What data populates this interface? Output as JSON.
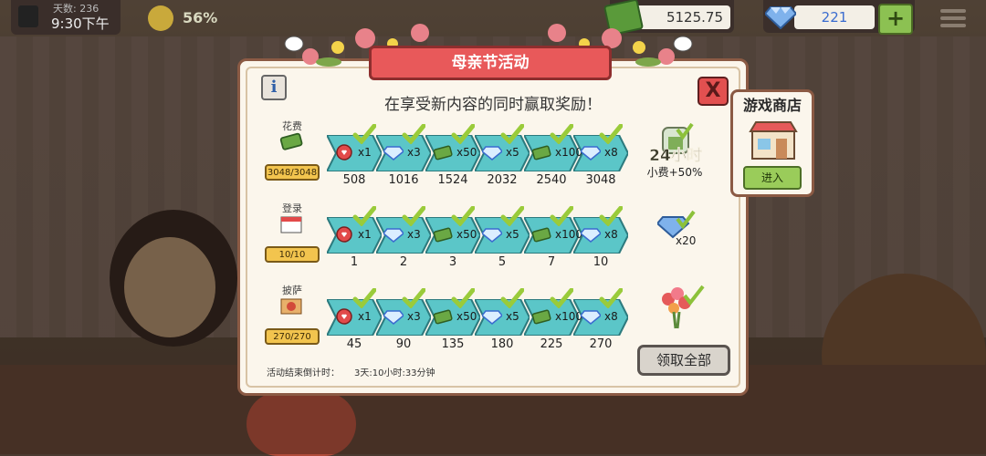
{
  "hud": {
    "day_label": "天数: 236",
    "time": "9:30下午",
    "mood_percent": "56%",
    "money": "5125.75",
    "gems": "221",
    "plus_label": "+"
  },
  "dialog": {
    "title": "母亲节活动",
    "subtitle": "在享受新内容的同时赢取奖励！",
    "info_label": "i",
    "close_label": "X",
    "collect_all_label": "领取全部",
    "countdown_label": "活动结束倒计时：",
    "countdown_value": "3天:10小时:33分钟",
    "rows": [
      {
        "label": "花费",
        "progress": "3048/3048",
        "tiers": [
          {
            "icon": "heart-coin-icon",
            "qty": "x1",
            "threshold": "508"
          },
          {
            "icon": "gem-icon",
            "qty": "x3",
            "threshold": "1016"
          },
          {
            "icon": "cash-icon",
            "qty": "x50",
            "threshold": "1524"
          },
          {
            "icon": "gem-icon",
            "qty": "x5",
            "threshold": "2032"
          },
          {
            "icon": "cash-icon",
            "qty": "x100",
            "threshold": "2540"
          },
          {
            "icon": "gem-icon",
            "qty": "x8",
            "threshold": "3048"
          }
        ],
        "final_reward": {
          "time": "24小时",
          "tip": "小费+50%"
        }
      },
      {
        "label": "登录",
        "progress": "10/10",
        "tiers": [
          {
            "icon": "heart-coin-icon",
            "qty": "x1",
            "threshold": "1"
          },
          {
            "icon": "gem-icon",
            "qty": "x3",
            "threshold": "2"
          },
          {
            "icon": "cash-icon",
            "qty": "x50",
            "threshold": "3"
          },
          {
            "icon": "gem-icon",
            "qty": "x5",
            "threshold": "5"
          },
          {
            "icon": "cash-icon",
            "qty": "x100",
            "threshold": "7"
          },
          {
            "icon": "gem-icon",
            "qty": "x8",
            "threshold": "10"
          }
        ],
        "final_reward": {
          "qty": "x20"
        }
      },
      {
        "label": "披萨",
        "progress": "270/270",
        "tiers": [
          {
            "icon": "heart-coin-icon",
            "qty": "x1",
            "threshold": "45"
          },
          {
            "icon": "gem-icon",
            "qty": "x3",
            "threshold": "90"
          },
          {
            "icon": "cash-icon",
            "qty": "x50",
            "threshold": "135"
          },
          {
            "icon": "gem-icon",
            "qty": "x5",
            "threshold": "180"
          },
          {
            "icon": "cash-icon",
            "qty": "x100",
            "threshold": "225"
          },
          {
            "icon": "gem-icon",
            "qty": "x8",
            "threshold": "270"
          }
        ],
        "final_reward": {
          "icon": "flower-bouquet-icon"
        }
      }
    ]
  },
  "shop": {
    "title": "游戏商店",
    "enter_label": "进入"
  },
  "colors": {
    "banner": "#e8595a",
    "chevron": "#5bc6c8",
    "check": "#9acb3a",
    "progress": "#f2c44e"
  }
}
